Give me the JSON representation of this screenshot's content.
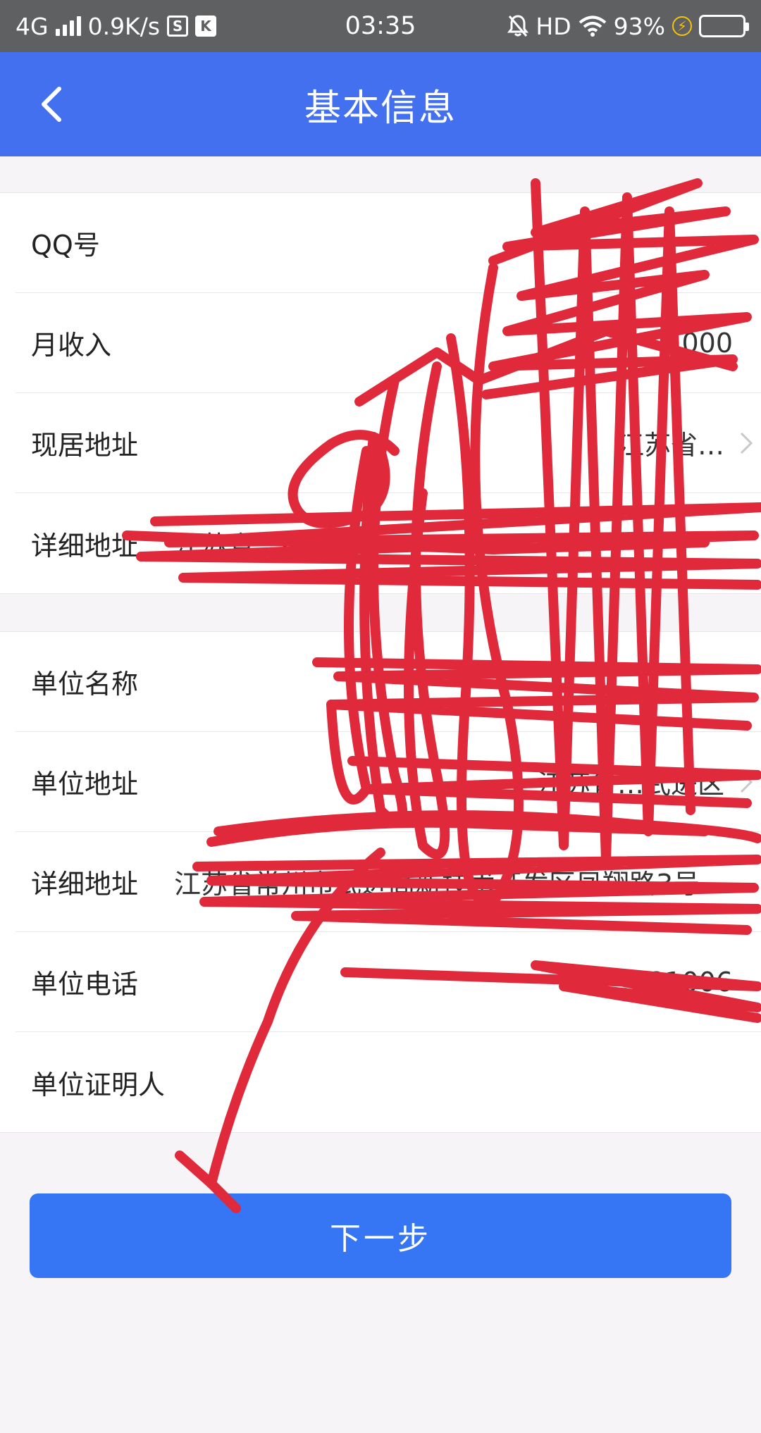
{
  "status_bar": {
    "network": "4G",
    "speed": "0.9K/s",
    "icon_a": "S",
    "icon_b": "K",
    "time": "03:35",
    "hd": "HD",
    "battery": "93%"
  },
  "nav": {
    "title": "基本信息",
    "back_icon": "chevron-left-icon"
  },
  "group1": {
    "rows": [
      {
        "label": "QQ号",
        "value": ""
      },
      {
        "label": "月收入",
        "value": "000"
      },
      {
        "label": "现居地址",
        "value": "江苏省…",
        "chevron": true
      },
      {
        "label": "详细地址",
        "value": "江苏省…6栋…"
      }
    ]
  },
  "group2": {
    "rows": [
      {
        "label": "单位名称",
        "value": ""
      },
      {
        "label": "单位地址",
        "value": "江苏省…武进区",
        "chevron": true
      },
      {
        "label": "详细地址",
        "value": "江苏省常州市武进高新技术开发区凤翔路3号"
      },
      {
        "label": "单位电话",
        "value": "…81006"
      },
      {
        "label": "单位证明人",
        "value": ""
      }
    ]
  },
  "next_button": {
    "label": "下一步"
  },
  "colors": {
    "nav_bg": "#4370ee",
    "button_bg": "#3676f4",
    "scribble": "#e02a3c",
    "status_bg": "#5f6061",
    "page_bg": "#f6f4f6"
  }
}
